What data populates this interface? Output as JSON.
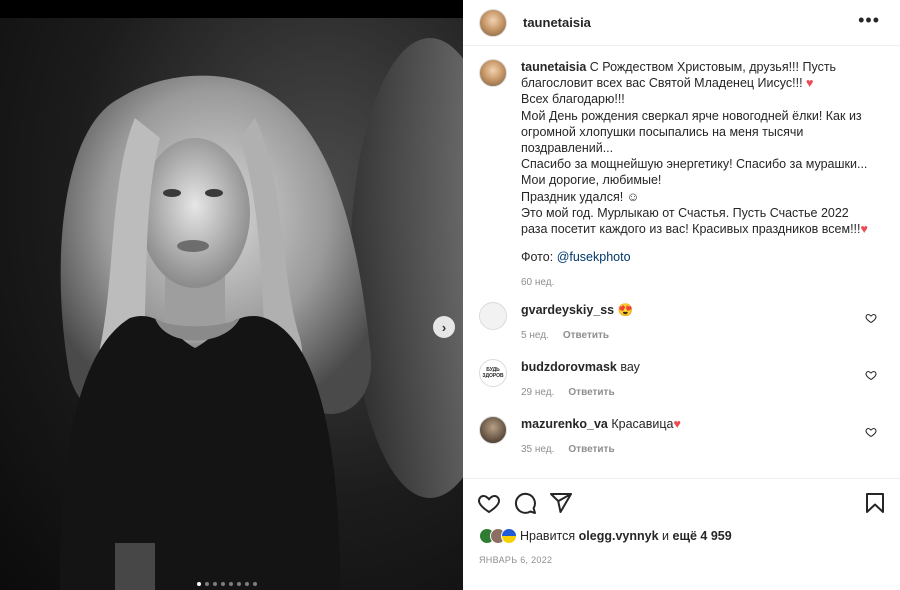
{
  "post": {
    "username": "taunetaisia",
    "more_icon": "more-horizontal-icon",
    "image_alt": "black-and-white portrait photo"
  },
  "caption": {
    "username": "taunetaisia",
    "lines": [
      "С Рождеством Христовым, друзья!!! Пусть благословит всех вас Святой Младенец Иисус!!!",
      "Всех благодарю!!!",
      "Мой День рождения сверкал ярче новогодней ёлки! Как из огромной хлопушки посыпались на меня тысячи поздравлений...",
      "Спасибо за мощнейшую энергетику! Спасибо за мурашки...",
      "Мои дорогие, любимые!",
      "Праздник удался! ☺",
      "Это мой год. Мурлыкаю от Счастья. Пусть Счастье 2022 раза посетит каждого из вас! Красивых праздников всем!!!"
    ],
    "heart": "♥",
    "photo_label": "Фото:",
    "photo_link": "@fusekphoto",
    "time": "60 нед."
  },
  "comments": [
    {
      "username": "gvardeyskiy_ss",
      "text": "😍",
      "time": "5 нед.",
      "reply": "Ответить"
    },
    {
      "username": "budzdorovmask",
      "text": "вау",
      "time": "29 нед.",
      "reply": "Ответить",
      "avatar_text": "БУДЬ ЗДОРОВ"
    },
    {
      "username": "mazurenko_va",
      "text": "Красавица",
      "heart": "♥",
      "time": "35 нед.",
      "reply": "Ответить"
    }
  ],
  "footer": {
    "likes_prefix": "Нравится",
    "likes_user": "olegg.vynnyk",
    "likes_middle": "и",
    "likes_more": "ещё 4 959",
    "date": "ЯНВАРЬ 6, 2022"
  },
  "icons": {
    "like": "heart-icon",
    "comment": "comment-icon",
    "share": "paper-plane-icon",
    "save": "bookmark-icon",
    "next": "chevron-right-icon"
  },
  "colors": {
    "accent_heart": "#ed4956",
    "link": "#00376b",
    "muted": "#8e8e8e"
  },
  "carousel": {
    "total": 8,
    "active": 1
  }
}
